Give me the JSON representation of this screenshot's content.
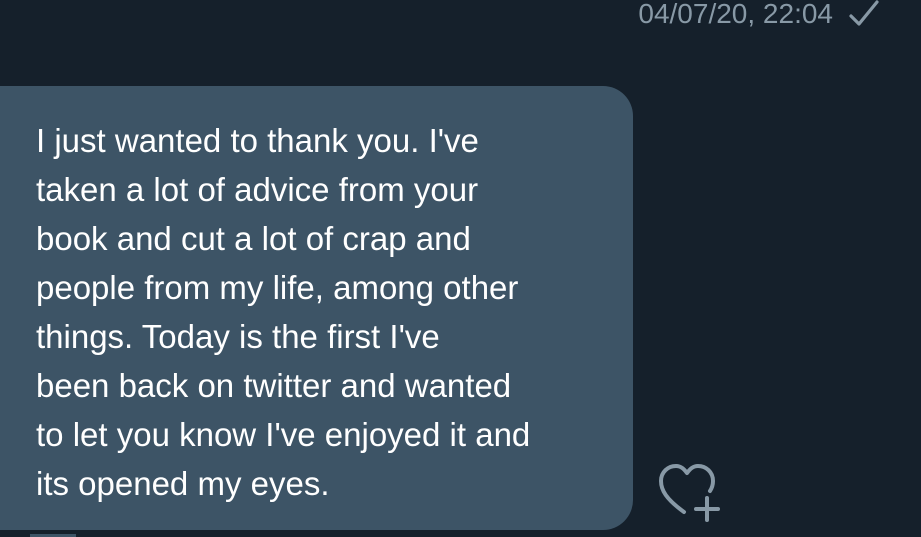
{
  "sent_message": {
    "timestamp": "04/07/20, 22:04",
    "status_icon": "check-icon"
  },
  "received_message": {
    "text": "I just wanted to thank you.  I've\ntaken a lot of advice from your\nbook and cut a lot of crap and\npeople from my life, among other\nthings.  Today is the first I've\nbeen back on twitter and wanted\nto let you know I've enjoyed it and\nits opened my eyes.",
    "bubble_color": "#3d5466",
    "text_color": "#ffffff"
  },
  "reaction_button": {
    "icon": "heart-plus-icon"
  },
  "theme": {
    "background": "#15202b",
    "meta_color": "#8899a6"
  }
}
